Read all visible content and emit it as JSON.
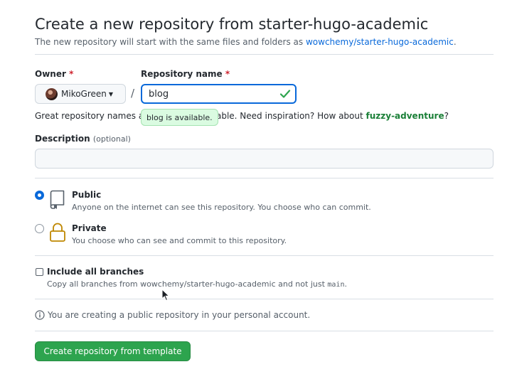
{
  "header": {
    "title": "Create a new repository from starter-hugo-academic",
    "subtitle_prefix": "The new repository will start with the same files and folders as ",
    "template_link": "wowchemy/starter-hugo-academic",
    "subtitle_suffix": "."
  },
  "owner": {
    "label": "Owner",
    "required_mark": "*",
    "selected": "MikoGreen",
    "icon": "avatar"
  },
  "separator": "/",
  "repo_name": {
    "label": "Repository name",
    "required_mark": "*",
    "value": "blog",
    "status_icon": "check-icon",
    "availability_tooltip": "blog is available."
  },
  "helper": {
    "before_tooltip": "Great repository names ar",
    "after_tooltip": "norable. Need inspiration? How about ",
    "suggestion": "fuzzy-adventure",
    "end": "?"
  },
  "description": {
    "label": "Description",
    "optional": "(optional)",
    "value": "",
    "placeholder": ""
  },
  "visibility": {
    "selected": "public",
    "options": [
      {
        "id": "public",
        "title": "Public",
        "note": "Anyone on the internet can see this repository. You choose who can commit.",
        "icon": "repo-icon"
      },
      {
        "id": "private",
        "title": "Private",
        "note": "You choose who can see and commit to this repository.",
        "icon": "lock-icon"
      }
    ]
  },
  "branches": {
    "checked": false,
    "label": "Include all branches",
    "note_prefix": "Copy all branches from wowchemy/starter-hugo-academic and not just ",
    "note_code": "main",
    "note_suffix": "."
  },
  "notice": {
    "icon": "info-icon",
    "text": "You are creating a public repository in your personal account."
  },
  "submit": {
    "label": "Create repository from template"
  },
  "colors": {
    "accent": "#0969da",
    "success": "#2da44e",
    "required": "#cf222e",
    "lock": "#bf8700"
  }
}
